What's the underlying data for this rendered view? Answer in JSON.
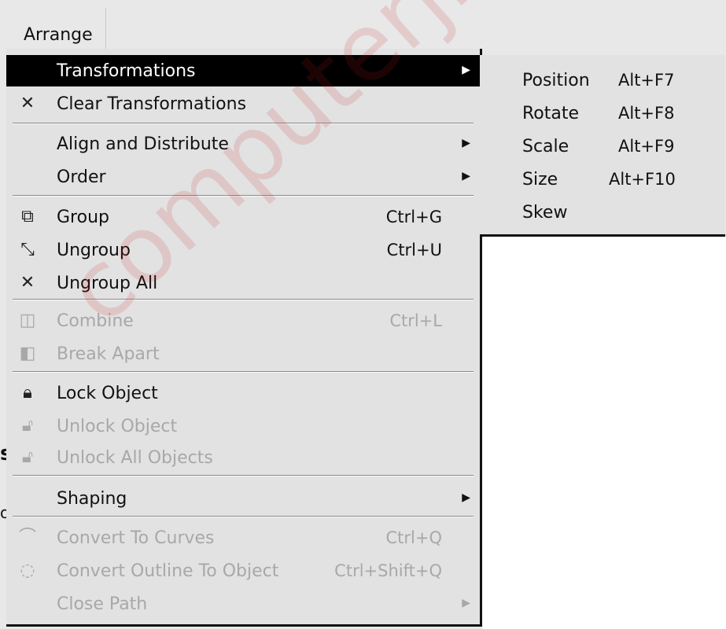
{
  "menubar": {
    "arrange_label": "Arrange"
  },
  "menu": {
    "transformations": {
      "label": "Transformations"
    },
    "clear_transformations": {
      "label": "Clear Transformations"
    },
    "align_distribute": {
      "label": "Align and Distribute"
    },
    "order": {
      "label": "Order"
    },
    "group": {
      "label": "Group",
      "shortcut": "Ctrl+G"
    },
    "ungroup": {
      "label": "Ungroup",
      "shortcut": "Ctrl+U"
    },
    "ungroup_all": {
      "label": "Ungroup All"
    },
    "combine": {
      "label": "Combine",
      "shortcut": "Ctrl+L"
    },
    "break_apart": {
      "label": "Break Apart"
    },
    "lock_object": {
      "label": "Lock Object"
    },
    "unlock_object": {
      "label": "Unlock Object"
    },
    "unlock_all": {
      "label": "Unlock All Objects"
    },
    "shaping": {
      "label": "Shaping"
    },
    "convert_curves": {
      "label": "Convert To Curves",
      "shortcut": "Ctrl+Q"
    },
    "convert_outline": {
      "label": "Convert Outline To Object",
      "shortcut": "Ctrl+Shift+Q"
    },
    "close_path": {
      "label": "Close Path"
    }
  },
  "submenu": {
    "position": {
      "label": "Position",
      "shortcut": "Alt+F7"
    },
    "rotate": {
      "label": "Rotate",
      "shortcut": "Alt+F8"
    },
    "scale": {
      "label": "Scale",
      "shortcut": "Alt+F9"
    },
    "size": {
      "label": "Size",
      "shortcut": "Alt+F10"
    },
    "skew": {
      "label": "Skew"
    }
  },
  "watermark": {
    "text": "computerjinn.blogsp"
  },
  "background_fragments": {
    "left_glyph_1": "s",
    "left_glyph_2": "oe"
  },
  "icons": {
    "clear_transformations": "clear-transformations-icon",
    "group": "group-icon",
    "ungroup": "ungroup-icon",
    "ungroup_all": "ungroup-all-icon",
    "combine": "combine-icon",
    "break_apart": "break-apart-icon",
    "lock": "lock-icon",
    "unlock": "unlock-icon",
    "unlock_all": "unlock-all-icon",
    "convert_curves": "convert-to-curves-icon",
    "convert_outline": "convert-outline-icon"
  },
  "colors": {
    "menu_bg": "#e2e2e2",
    "highlight_bg": "#000000",
    "highlight_text": "#ffffff",
    "disabled_text": "#a8a8a8",
    "watermark": "#cd1e1e"
  }
}
